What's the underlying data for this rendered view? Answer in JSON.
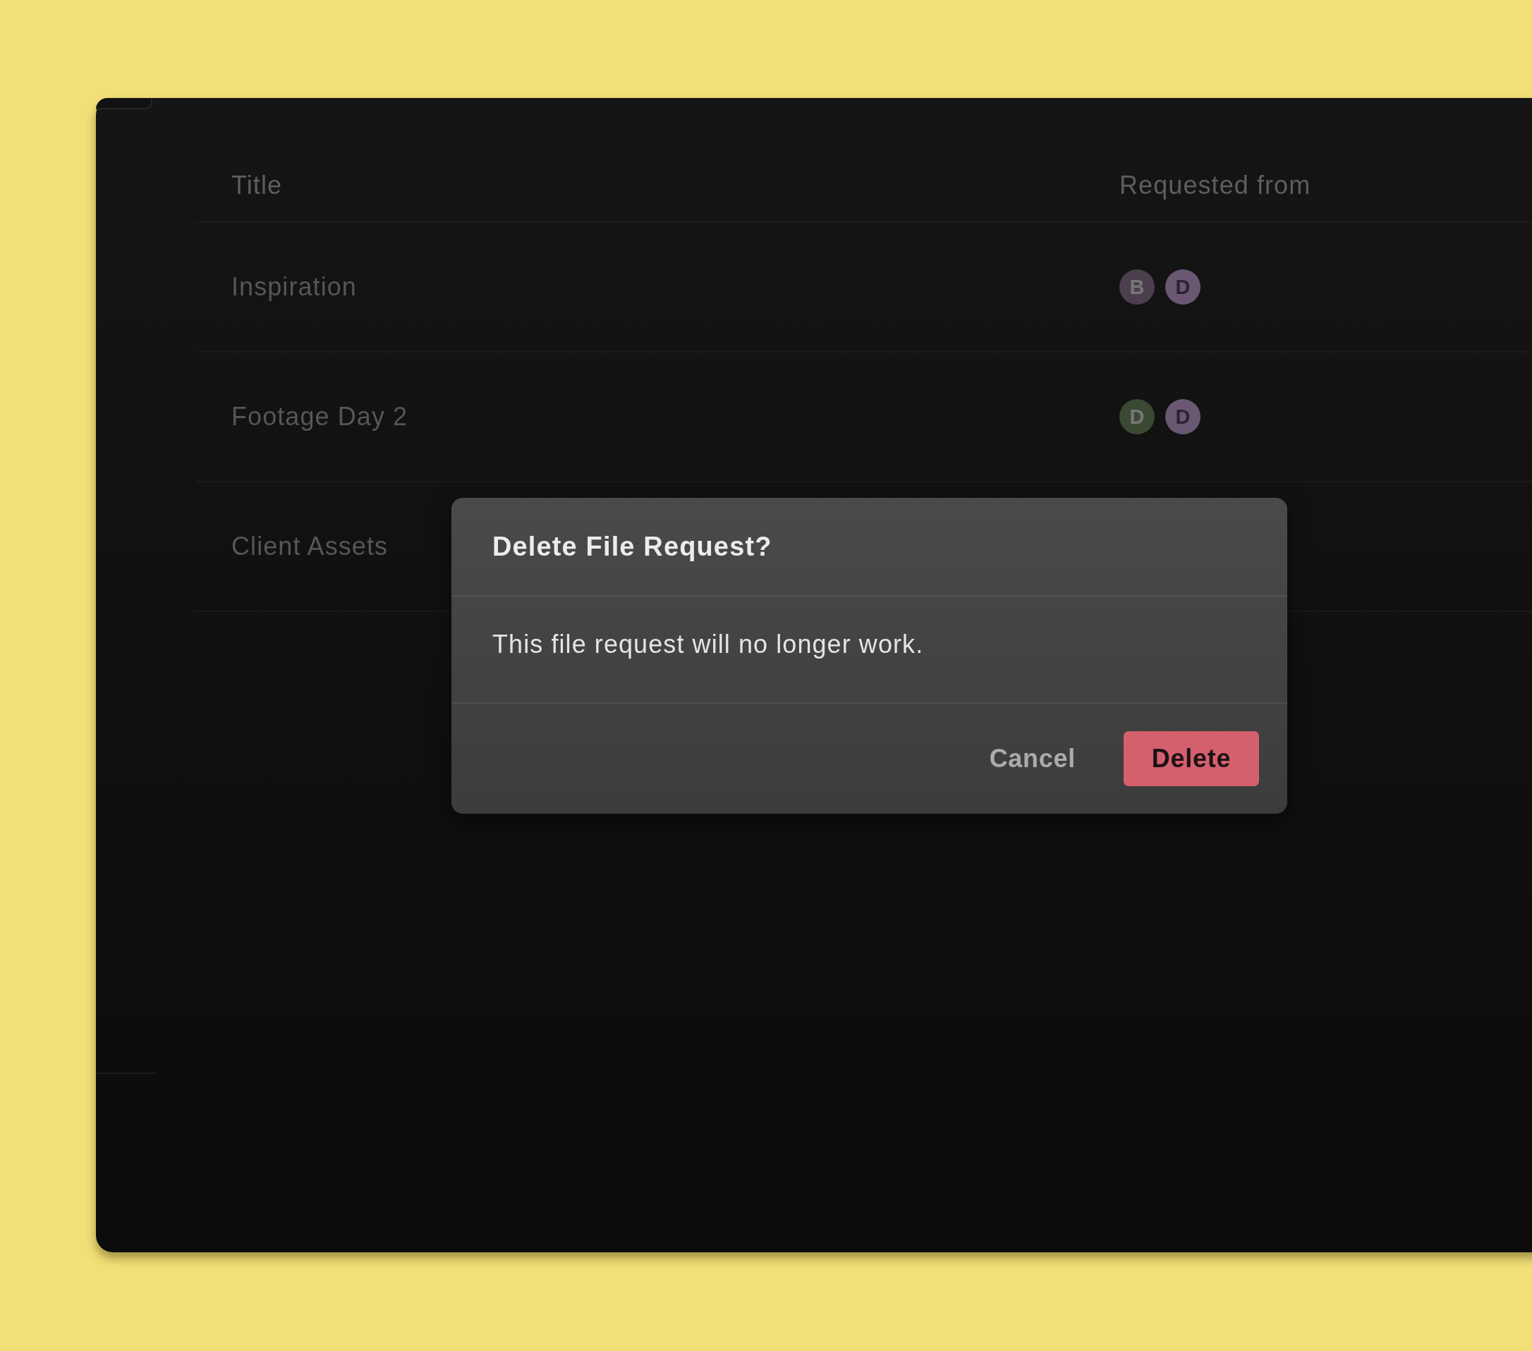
{
  "table": {
    "columns": [
      "Title",
      "Requested from"
    ],
    "rows": [
      {
        "title": "Inspiration",
        "requested_from": [
          {
            "initial": "B",
            "color": "#4b3f4e"
          },
          {
            "initial": "D",
            "color": "#6a5873"
          }
        ]
      },
      {
        "title": "Footage Day 2",
        "requested_from": [
          {
            "initial": "D",
            "color": "#3a4932"
          },
          {
            "initial": "D",
            "color": "#6a5873"
          }
        ]
      },
      {
        "title": "Client Assets"
      }
    ]
  },
  "dialog": {
    "title": "Delete File Request?",
    "message": "This file request will no longer work.",
    "buttons": [
      {
        "label": "Cancel",
        "kind": "secondary"
      },
      {
        "label": "Delete",
        "kind": "danger"
      }
    ]
  }
}
